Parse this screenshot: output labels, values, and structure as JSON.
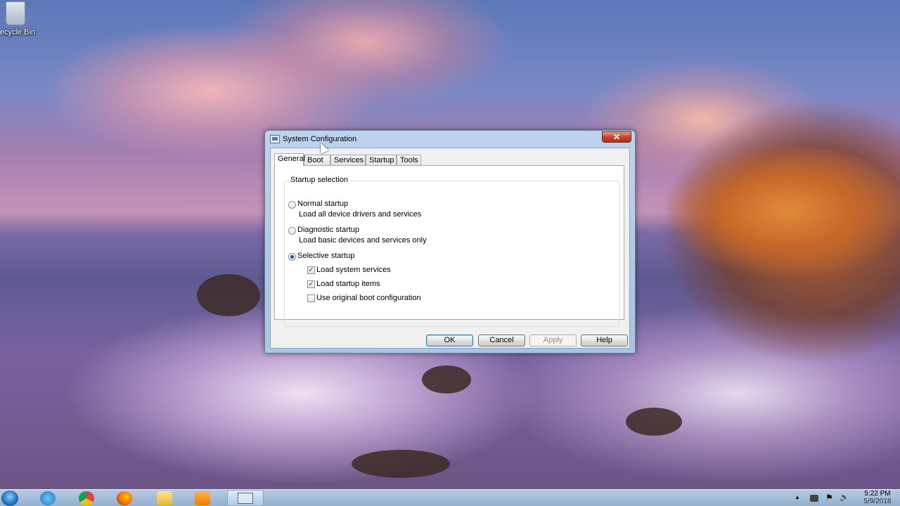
{
  "desktop": {
    "recycle_bin_label": "ecycle Bin"
  },
  "dialog": {
    "title": "System Configuration",
    "close_label": "✕",
    "tabs": [
      {
        "label": "General",
        "active": true
      },
      {
        "label": "Boot",
        "active": false
      },
      {
        "label": "Services",
        "active": false
      },
      {
        "label": "Startup",
        "active": false
      },
      {
        "label": "Tools",
        "active": false
      }
    ],
    "group_title": "Startup selection",
    "options": {
      "normal": {
        "label": "Normal startup",
        "description": "Load all device drivers and services",
        "selected": false
      },
      "diagnostic": {
        "label": "Diagnostic startup",
        "description": "Load basic devices and services only",
        "selected": false
      },
      "selective": {
        "label": "Selective startup",
        "selected": true
      }
    },
    "checkboxes": {
      "system_services": {
        "label": "Load system services",
        "checked": true
      },
      "startup_items": {
        "label": "Load startup items",
        "checked": true
      },
      "original_boot": {
        "label": "Use original boot configuration",
        "checked": false
      }
    },
    "buttons": {
      "ok": "OK",
      "cancel": "Cancel",
      "apply": "Apply",
      "help": "Help"
    }
  },
  "taskbar": {
    "pinned": [
      "Start",
      "Internet Explorer",
      "Google Chrome",
      "Mozilla Firefox",
      "File Explorer",
      "Windows Media Player",
      "System Configuration"
    ],
    "clock": {
      "time": "5:22 PM",
      "date": "5/9/2018"
    },
    "tray_arrow": "▲",
    "flag_icon": "⚑",
    "volume_icon": "🔊"
  }
}
